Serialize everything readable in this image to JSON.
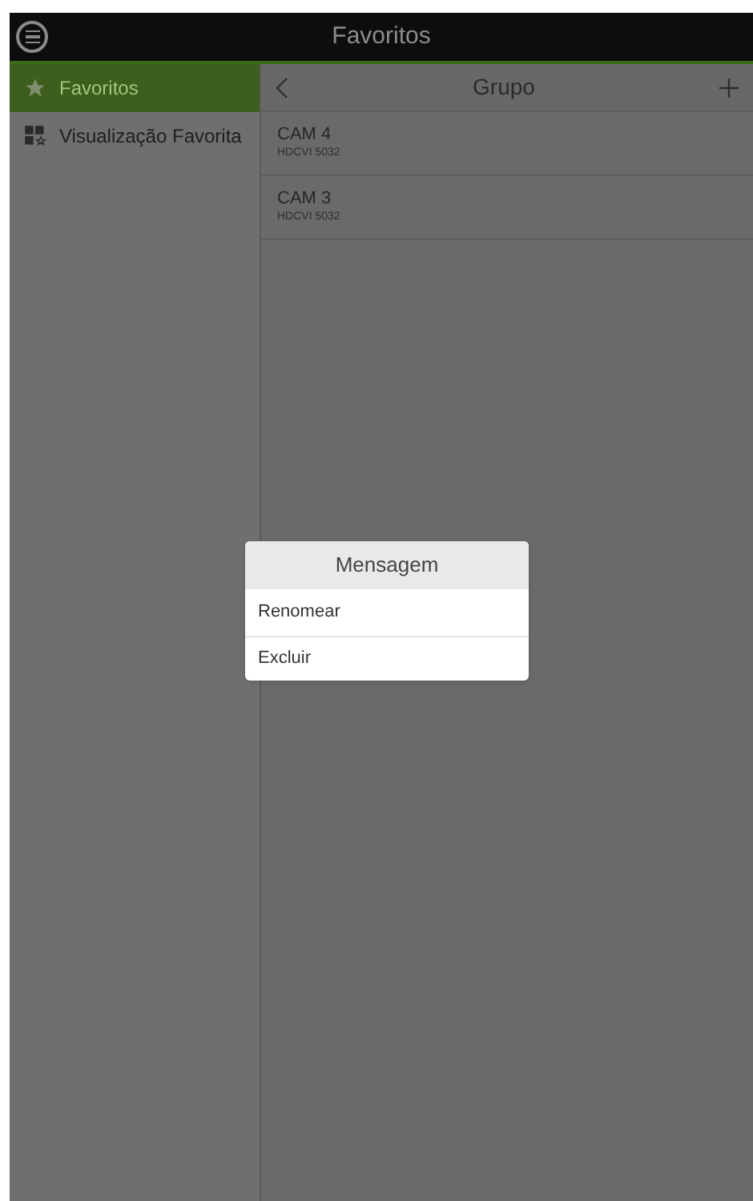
{
  "header": {
    "title": "Favoritos"
  },
  "sidebar": {
    "items": [
      {
        "label": "Favoritos",
        "selected": true
      },
      {
        "label": "Visualização Favorita",
        "selected": false
      }
    ]
  },
  "panel": {
    "title": "Grupo",
    "rows": [
      {
        "name": "CAM 4",
        "device": "HDCVI 5032"
      },
      {
        "name": "CAM 3",
        "device": "HDCVI 5032"
      }
    ]
  },
  "dialog": {
    "title": "Mensagem",
    "options": [
      "Renomear",
      "Excluir"
    ]
  }
}
